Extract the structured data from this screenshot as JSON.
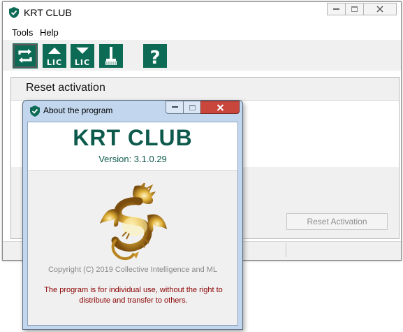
{
  "main_window": {
    "title": "KRT CLUB",
    "menu": [
      "Tools",
      "Help"
    ],
    "toolbar": {
      "buttons": [
        {
          "name": "refresh-icon"
        },
        {
          "name": "upload-license-icon",
          "label": "LIC"
        },
        {
          "name": "download-license-icon",
          "label": "LIC"
        },
        {
          "name": "broom-icon"
        },
        {
          "name": "help-icon",
          "label": "?"
        }
      ]
    },
    "panel_title": "Reset activation",
    "reset_button": "Reset Activation"
  },
  "about_dialog": {
    "title": "About the program",
    "app_name": "KRT CLUB",
    "version": "Version: 3.1.0.29",
    "copyright": "Copyright (C) 2019 Collective Intelligence and ML",
    "notice": "The program is for individual use, without the right to distribute and transfer to others."
  },
  "colors": {
    "brand_green": "#0d6b55",
    "notice_red": "#8b0000",
    "dialog_frame": "#c2d7ee",
    "close_red": "#c9463d"
  }
}
